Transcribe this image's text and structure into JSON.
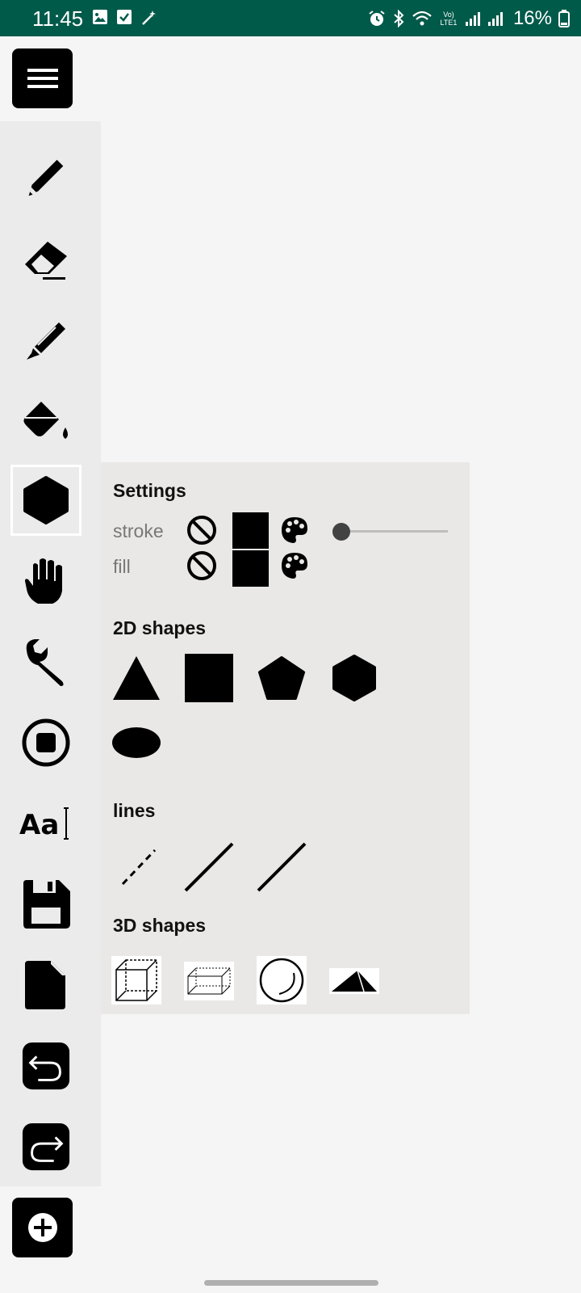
{
  "status_bar": {
    "time": "11:45",
    "signal_label": "Vo) LTE1",
    "battery": "16%"
  },
  "toolbar": {
    "tools": [
      "pencil-icon",
      "eraser-icon",
      "marker-icon",
      "fill-bucket-icon",
      "shapes-icon",
      "hand-icon",
      "wrench-icon",
      "record-icon",
      "text-icon",
      "save-icon",
      "new-page-icon",
      "undo-icon",
      "redo-icon"
    ],
    "active_tool": "shapes-icon"
  },
  "panel": {
    "settings_title": "Settings",
    "stroke_label": "stroke",
    "fill_label": "fill",
    "stroke_color": "#000000",
    "fill_color": "#000000",
    "stroke_width_level": 0.0,
    "section_2d": "2D shapes",
    "shapes_2d": [
      "triangle",
      "square",
      "pentagon",
      "hexagon",
      "ellipse"
    ],
    "section_lines": "lines",
    "lines": [
      "dashed-line",
      "line",
      "line"
    ],
    "section_3d": "3D shapes",
    "shapes_3d": [
      "cube",
      "cuboid",
      "sphere",
      "pyramid"
    ]
  },
  "colors": {
    "status_bar": "#005a4a",
    "canvas": "#f5f5f5",
    "toolbar": "#ebebeb",
    "panel": "#e9e8e6",
    "icon": "#000000"
  }
}
